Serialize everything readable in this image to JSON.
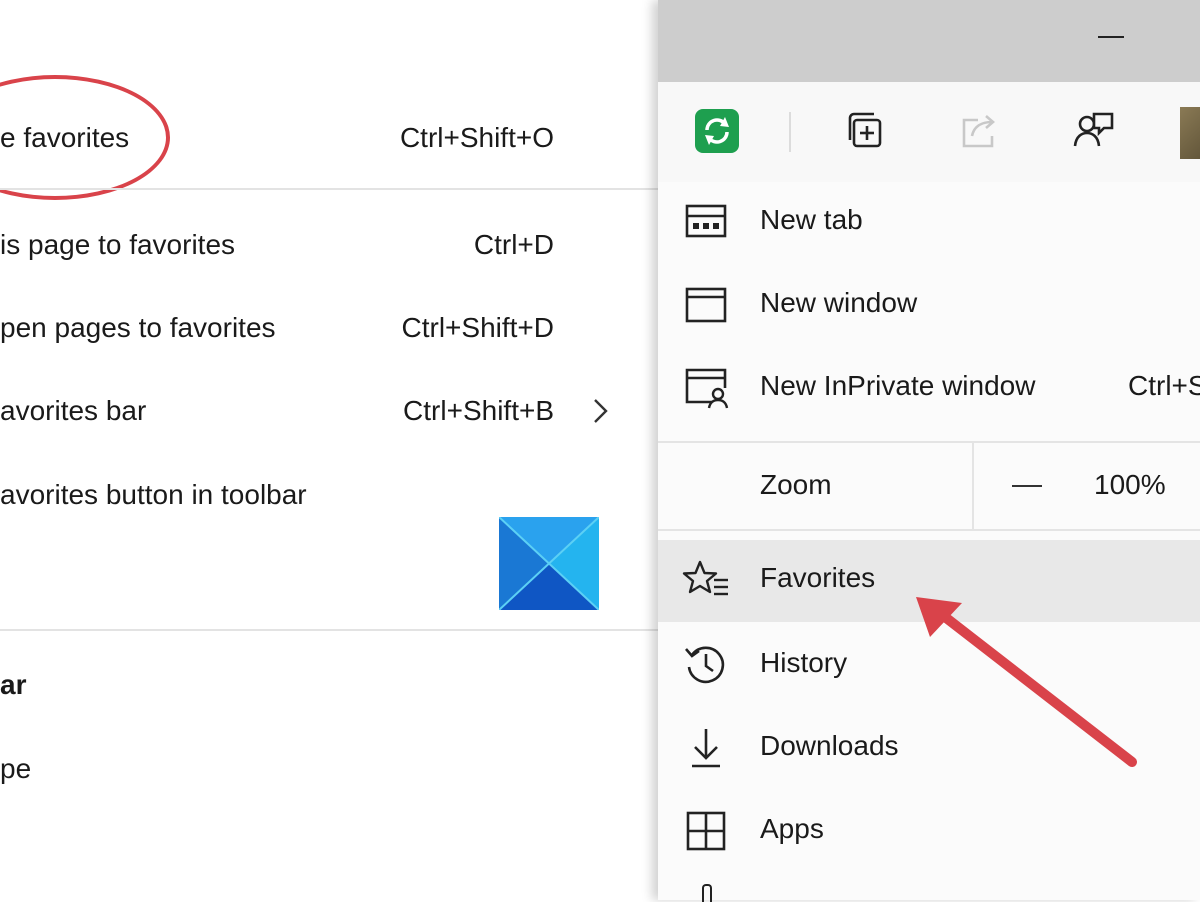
{
  "favorites_submenu": {
    "items": [
      {
        "label": "e favorites",
        "shortcut": "Ctrl+Shift+O"
      },
      {
        "label": "is page to favorites",
        "shortcut": "Ctrl+D"
      },
      {
        "label": "pen pages to favorites",
        "shortcut": "Ctrl+Shift+D"
      },
      {
        "label": "avorites bar",
        "shortcut": "Ctrl+Shift+B"
      },
      {
        "label": "avorites button in toolbar",
        "shortcut": ""
      }
    ],
    "lower_items": [
      {
        "label": "ar"
      },
      {
        "label": "pe"
      }
    ]
  },
  "browser_menu": {
    "toolbar_icons": [
      "refresh-extension-icon",
      "collections-icon",
      "share-icon",
      "feedback-icon"
    ],
    "items": [
      {
        "label": "New tab",
        "icon": "new-tab-icon",
        "shortcut": ""
      },
      {
        "label": "New window",
        "icon": "new-window-icon",
        "shortcut": ""
      },
      {
        "label": "New InPrivate window",
        "icon": "inprivate-icon",
        "shortcut": "Ctrl+S"
      },
      {
        "label": "Favorites",
        "icon": "favorites-icon",
        "shortcut": ""
      },
      {
        "label": "History",
        "icon": "history-icon",
        "shortcut": ""
      },
      {
        "label": "Downloads",
        "icon": "downloads-icon",
        "shortcut": ""
      },
      {
        "label": "Apps",
        "icon": "apps-icon",
        "shortcut": ""
      }
    ],
    "zoom": {
      "label": "Zoom",
      "value": "100%"
    }
  },
  "colors": {
    "annotation_red": "#d9434a",
    "extension_green": "#1e9f4f",
    "highlight": "#e8e8e8"
  }
}
